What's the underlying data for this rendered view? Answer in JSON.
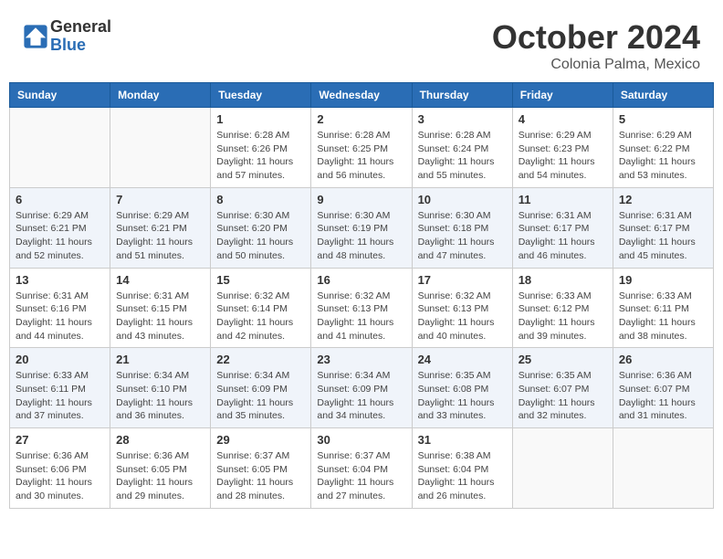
{
  "header": {
    "logo_line1": "General",
    "logo_line2": "Blue",
    "title": "October 2024",
    "subtitle": "Colonia Palma, Mexico"
  },
  "days_of_week": [
    "Sunday",
    "Monday",
    "Tuesday",
    "Wednesday",
    "Thursday",
    "Friday",
    "Saturday"
  ],
  "weeks": [
    [
      {
        "day": "",
        "info": ""
      },
      {
        "day": "",
        "info": ""
      },
      {
        "day": "1",
        "info": "Sunrise: 6:28 AM\nSunset: 6:26 PM\nDaylight: 11 hours\nand 57 minutes."
      },
      {
        "day": "2",
        "info": "Sunrise: 6:28 AM\nSunset: 6:25 PM\nDaylight: 11 hours\nand 56 minutes."
      },
      {
        "day": "3",
        "info": "Sunrise: 6:28 AM\nSunset: 6:24 PM\nDaylight: 11 hours\nand 55 minutes."
      },
      {
        "day": "4",
        "info": "Sunrise: 6:29 AM\nSunset: 6:23 PM\nDaylight: 11 hours\nand 54 minutes."
      },
      {
        "day": "5",
        "info": "Sunrise: 6:29 AM\nSunset: 6:22 PM\nDaylight: 11 hours\nand 53 minutes."
      }
    ],
    [
      {
        "day": "6",
        "info": "Sunrise: 6:29 AM\nSunset: 6:21 PM\nDaylight: 11 hours\nand 52 minutes."
      },
      {
        "day": "7",
        "info": "Sunrise: 6:29 AM\nSunset: 6:21 PM\nDaylight: 11 hours\nand 51 minutes."
      },
      {
        "day": "8",
        "info": "Sunrise: 6:30 AM\nSunset: 6:20 PM\nDaylight: 11 hours\nand 50 minutes."
      },
      {
        "day": "9",
        "info": "Sunrise: 6:30 AM\nSunset: 6:19 PM\nDaylight: 11 hours\nand 48 minutes."
      },
      {
        "day": "10",
        "info": "Sunrise: 6:30 AM\nSunset: 6:18 PM\nDaylight: 11 hours\nand 47 minutes."
      },
      {
        "day": "11",
        "info": "Sunrise: 6:31 AM\nSunset: 6:17 PM\nDaylight: 11 hours\nand 46 minutes."
      },
      {
        "day": "12",
        "info": "Sunrise: 6:31 AM\nSunset: 6:17 PM\nDaylight: 11 hours\nand 45 minutes."
      }
    ],
    [
      {
        "day": "13",
        "info": "Sunrise: 6:31 AM\nSunset: 6:16 PM\nDaylight: 11 hours\nand 44 minutes."
      },
      {
        "day": "14",
        "info": "Sunrise: 6:31 AM\nSunset: 6:15 PM\nDaylight: 11 hours\nand 43 minutes."
      },
      {
        "day": "15",
        "info": "Sunrise: 6:32 AM\nSunset: 6:14 PM\nDaylight: 11 hours\nand 42 minutes."
      },
      {
        "day": "16",
        "info": "Sunrise: 6:32 AM\nSunset: 6:13 PM\nDaylight: 11 hours\nand 41 minutes."
      },
      {
        "day": "17",
        "info": "Sunrise: 6:32 AM\nSunset: 6:13 PM\nDaylight: 11 hours\nand 40 minutes."
      },
      {
        "day": "18",
        "info": "Sunrise: 6:33 AM\nSunset: 6:12 PM\nDaylight: 11 hours\nand 39 minutes."
      },
      {
        "day": "19",
        "info": "Sunrise: 6:33 AM\nSunset: 6:11 PM\nDaylight: 11 hours\nand 38 minutes."
      }
    ],
    [
      {
        "day": "20",
        "info": "Sunrise: 6:33 AM\nSunset: 6:11 PM\nDaylight: 11 hours\nand 37 minutes."
      },
      {
        "day": "21",
        "info": "Sunrise: 6:34 AM\nSunset: 6:10 PM\nDaylight: 11 hours\nand 36 minutes."
      },
      {
        "day": "22",
        "info": "Sunrise: 6:34 AM\nSunset: 6:09 PM\nDaylight: 11 hours\nand 35 minutes."
      },
      {
        "day": "23",
        "info": "Sunrise: 6:34 AM\nSunset: 6:09 PM\nDaylight: 11 hours\nand 34 minutes."
      },
      {
        "day": "24",
        "info": "Sunrise: 6:35 AM\nSunset: 6:08 PM\nDaylight: 11 hours\nand 33 minutes."
      },
      {
        "day": "25",
        "info": "Sunrise: 6:35 AM\nSunset: 6:07 PM\nDaylight: 11 hours\nand 32 minutes."
      },
      {
        "day": "26",
        "info": "Sunrise: 6:36 AM\nSunset: 6:07 PM\nDaylight: 11 hours\nand 31 minutes."
      }
    ],
    [
      {
        "day": "27",
        "info": "Sunrise: 6:36 AM\nSunset: 6:06 PM\nDaylight: 11 hours\nand 30 minutes."
      },
      {
        "day": "28",
        "info": "Sunrise: 6:36 AM\nSunset: 6:05 PM\nDaylight: 11 hours\nand 29 minutes."
      },
      {
        "day": "29",
        "info": "Sunrise: 6:37 AM\nSunset: 6:05 PM\nDaylight: 11 hours\nand 28 minutes."
      },
      {
        "day": "30",
        "info": "Sunrise: 6:37 AM\nSunset: 6:04 PM\nDaylight: 11 hours\nand 27 minutes."
      },
      {
        "day": "31",
        "info": "Sunrise: 6:38 AM\nSunset: 6:04 PM\nDaylight: 11 hours\nand 26 minutes."
      },
      {
        "day": "",
        "info": ""
      },
      {
        "day": "",
        "info": ""
      }
    ]
  ]
}
